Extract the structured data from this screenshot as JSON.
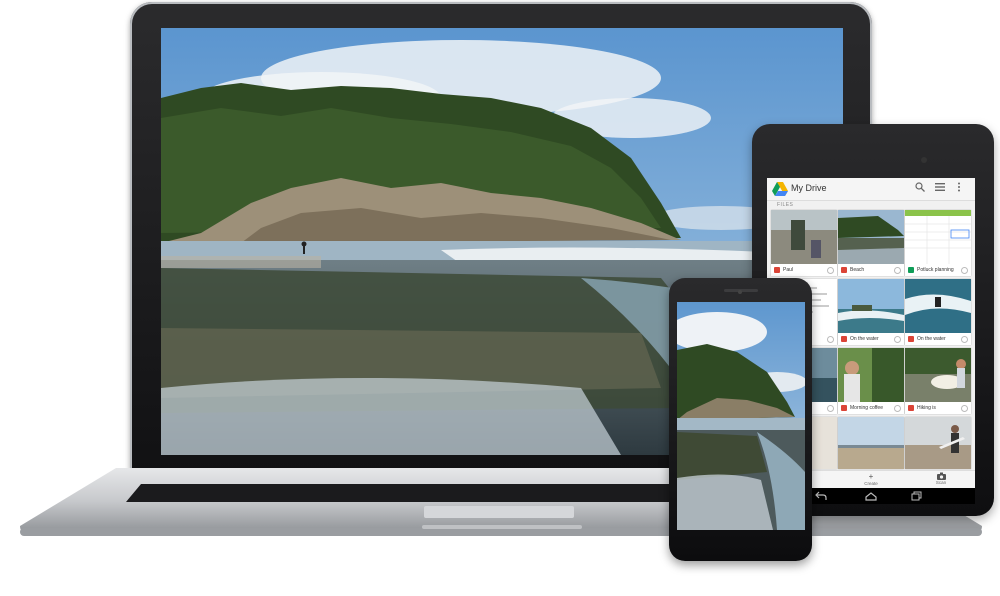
{
  "laptop": {
    "wallpaper": "coastal-forest-beach-photo"
  },
  "tablet": {
    "app": {
      "title": "My Drive",
      "section_label": "FILES",
      "files": [
        {
          "name": "Paul",
          "type": "image",
          "thumb": "beach-person"
        },
        {
          "name": "Beach",
          "type": "image",
          "thumb": "forest-beach"
        },
        {
          "name": "Potluck planning",
          "type": "spreadsheet",
          "thumb": "spreadsheet"
        },
        {
          "name": "",
          "type": "document",
          "thumb": "document"
        },
        {
          "name": "On the water",
          "type": "image",
          "thumb": "surf"
        },
        {
          "name": "On the water",
          "type": "image",
          "thumb": "surf"
        },
        {
          "name": "",
          "type": "image",
          "thumb": "partial"
        },
        {
          "name": "Morning coffee",
          "type": "image",
          "thumb": "person-green"
        },
        {
          "name": "Hiking is",
          "type": "image",
          "thumb": "surfer-board"
        },
        {
          "name": "",
          "type": "image",
          "thumb": "partial"
        },
        {
          "name": "",
          "type": "image",
          "thumb": "beach-sky"
        },
        {
          "name": "",
          "type": "image",
          "thumb": "surfer-walk"
        }
      ],
      "bottom_actions": [
        {
          "label": "Create",
          "icon": "plus-icon"
        },
        {
          "label": "Scan",
          "icon": "camera-icon"
        }
      ]
    },
    "nav_keys": [
      "back-icon",
      "home-icon",
      "recents-icon"
    ]
  },
  "phone": {
    "wallpaper": "coastal-forest-beach-photo"
  },
  "colors": {
    "sky": "#6ea5d6",
    "forest": "#2f4a23",
    "sand": "#8a7a62",
    "device_black": "#111113",
    "drive_image_red": "#db4437",
    "drive_sheet_green": "#0f9d58"
  }
}
